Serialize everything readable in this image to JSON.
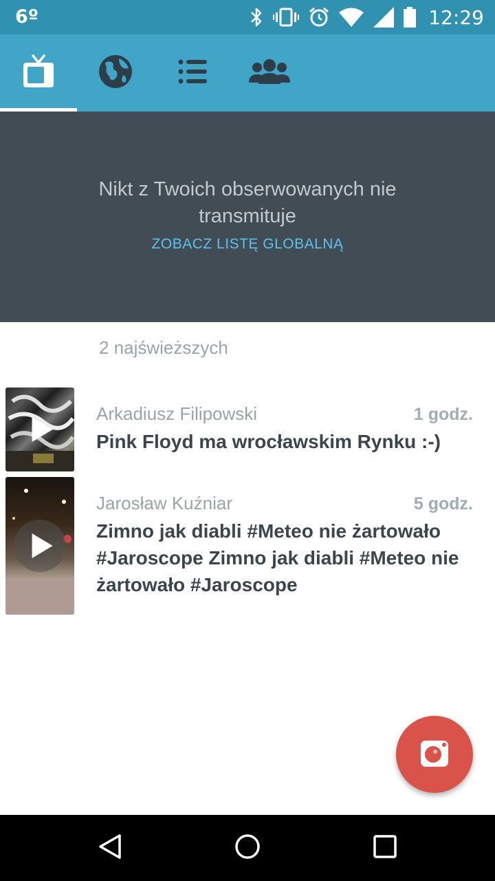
{
  "status_bar": {
    "temperature": "6º",
    "time": "12:29",
    "icons": [
      "bluetooth-icon",
      "vibrate-icon",
      "alarm-icon",
      "wifi-icon",
      "signal-icon",
      "battery-icon"
    ]
  },
  "tabs": [
    {
      "name": "tab-live",
      "icon": "tv-icon",
      "selected": true
    },
    {
      "name": "tab-global",
      "icon": "globe-icon",
      "selected": false
    },
    {
      "name": "tab-list",
      "icon": "list-icon",
      "selected": false
    },
    {
      "name": "tab-people",
      "icon": "people-icon",
      "selected": false
    }
  ],
  "banner": {
    "message": "Nikt z Twoich obserwowanych nie transmituje",
    "link": "ZOBACZ LISTĘ GLOBALNĄ"
  },
  "section": {
    "header": "2 najświeższych"
  },
  "broadcasts": [
    {
      "author": "Arkadiusz Filipowski",
      "time": "1 godz.",
      "title": "Pink Floyd ma wrocławskim Rynku :-)"
    },
    {
      "author": "Jarosław Kuźniar",
      "time": "5 godz.",
      "title": "Zimno jak diabli #Meteo nie żartowało #Jaroscope Zimno jak diabli #Meteo nie żartowało #Jaroscope"
    }
  ],
  "fab": {
    "icon": "camera-icon"
  },
  "nav": {
    "icons": [
      "back-icon",
      "home-icon",
      "recents-icon"
    ]
  },
  "colors": {
    "status_bar": "#3091b0",
    "tab_bar": "#40a5c6",
    "banner": "#414c54",
    "link": "#5cc3ea",
    "fab": "#d9534a"
  }
}
